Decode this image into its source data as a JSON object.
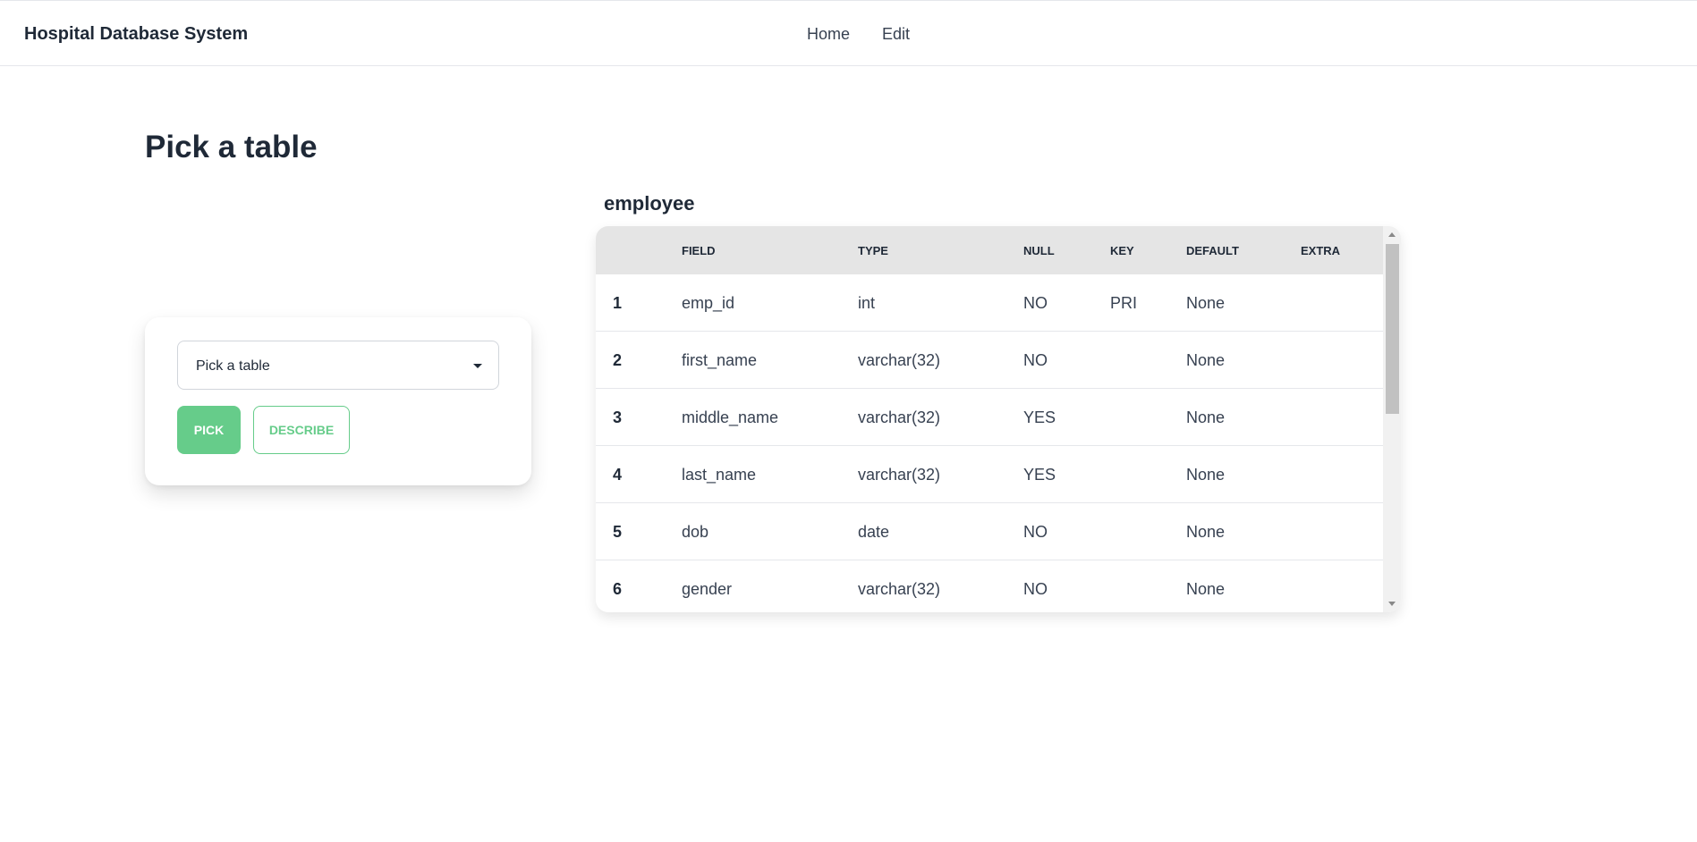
{
  "app": {
    "title": "Hospital Database System"
  },
  "nav": {
    "items": [
      {
        "label": "Home"
      },
      {
        "label": "Edit"
      }
    ]
  },
  "page": {
    "title": "Pick a table"
  },
  "picker": {
    "selected": "Pick a table",
    "pick_label": "PICK",
    "describe_label": "DESCRIBE"
  },
  "table": {
    "name": "employee",
    "headers": [
      "FIELD",
      "TYPE",
      "NULL",
      "KEY",
      "DEFAULT",
      "EXTRA"
    ],
    "rows": [
      {
        "index": "1",
        "field": "emp_id",
        "type": "int",
        "null": "NO",
        "key": "PRI",
        "default": "None",
        "extra": ""
      },
      {
        "index": "2",
        "field": "first_name",
        "type": "varchar(32)",
        "null": "NO",
        "key": "",
        "default": "None",
        "extra": ""
      },
      {
        "index": "3",
        "field": "middle_name",
        "type": "varchar(32)",
        "null": "YES",
        "key": "",
        "default": "None",
        "extra": ""
      },
      {
        "index": "4",
        "field": "last_name",
        "type": "varchar(32)",
        "null": "YES",
        "key": "",
        "default": "None",
        "extra": ""
      },
      {
        "index": "5",
        "field": "dob",
        "type": "date",
        "null": "NO",
        "key": "",
        "default": "None",
        "extra": ""
      },
      {
        "index": "6",
        "field": "gender",
        "type": "varchar(32)",
        "null": "NO",
        "key": "",
        "default": "None",
        "extra": ""
      }
    ]
  },
  "colors": {
    "accent": "#66cc8a",
    "header_bg": "#e5e5e5",
    "text": "#1f2937"
  }
}
